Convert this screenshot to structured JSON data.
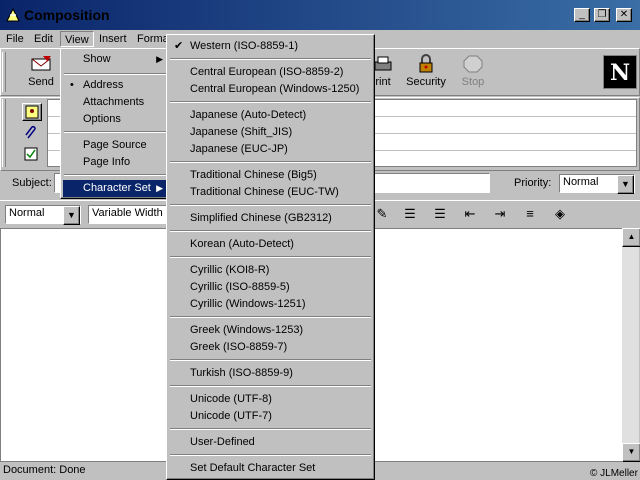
{
  "window": {
    "title": "Composition",
    "min_label": "_",
    "max_label": "❐",
    "close_label": "✕"
  },
  "menubar": {
    "items": [
      "File",
      "Edit",
      "View",
      "Insert",
      "Forma"
    ]
  },
  "toolbar": {
    "send": "Send",
    "print": "rint",
    "security": "Security",
    "stop": "Stop",
    "logo": "N"
  },
  "subject": {
    "label": "Subject:",
    "value": ""
  },
  "priority": {
    "label": "Priority:",
    "value": "Normal"
  },
  "format": {
    "paragraph": "Normal",
    "font": "Variable Width"
  },
  "status": {
    "text": "Document: Done",
    "copyright": "© JLMeller"
  },
  "view_menu": {
    "show": "Show",
    "address": "Address",
    "attachments": "Attachments",
    "options": "Options",
    "page_source": "Page Source",
    "page_info": "Page Info",
    "character_set": "Character Set",
    "bullet": "•",
    "arrow": "▶"
  },
  "charset_menu": {
    "check": "✔",
    "groups": [
      [
        "Western (ISO-8859-1)"
      ],
      [
        "Central European (ISO-8859-2)",
        "Central European (Windows-1250)"
      ],
      [
        "Japanese (Auto-Detect)",
        "Japanese (Shift_JIS)",
        "Japanese (EUC-JP)"
      ],
      [
        "Traditional Chinese (Big5)",
        "Traditional Chinese (EUC-TW)"
      ],
      [
        "Simplified Chinese (GB2312)"
      ],
      [
        "Korean (Auto-Detect)"
      ],
      [
        "Cyrillic (KOI8-R)",
        "Cyrillic (ISO-8859-5)",
        "Cyrillic (Windows-1251)"
      ],
      [
        "Greek (Windows-1253)",
        "Greek (ISO-8859-7)"
      ],
      [
        "Turkish (ISO-8859-9)"
      ],
      [
        "Unicode (UTF-8)",
        "Unicode (UTF-7)"
      ],
      [
        "User-Defined"
      ],
      [
        "Set Default Character Set"
      ]
    ]
  },
  "colors": {
    "title_bar": "#0a246a",
    "menu_highlight": "#0a246a",
    "face": "#c0c0c0"
  }
}
